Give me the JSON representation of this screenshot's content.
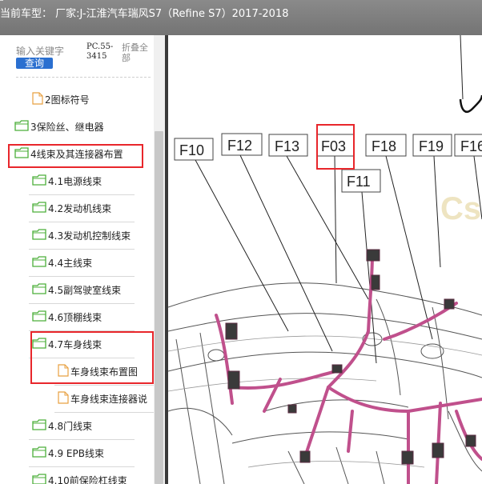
{
  "title_bar": {
    "text": "当前车型： 厂家:J-江淮汽车瑞风S7（Refine S7）2017-2018"
  },
  "search": {
    "placeholder": "输入关键字",
    "button_label": "查询",
    "code_text": "PC.55-\n3415",
    "collapse_label": "折叠全部"
  },
  "tree": {
    "items": [
      {
        "label": "2图标符号",
        "type": "file"
      },
      {
        "label": "3保险丝、继电器",
        "type": "folder"
      },
      {
        "label": "4线束及其连接器布置",
        "type": "folder"
      },
      {
        "label": "4.1电源线束",
        "type": "folder"
      },
      {
        "label": "4.2发动机线束",
        "type": "folder"
      },
      {
        "label": "4.3发动机控制线束",
        "type": "folder"
      },
      {
        "label": "4.4主线束",
        "type": "folder"
      },
      {
        "label": "4.5副驾驶室线束",
        "type": "folder"
      },
      {
        "label": "4.6顶棚线束",
        "type": "folder"
      },
      {
        "label": "4.7车身线束",
        "type": "folder"
      },
      {
        "label": "车身线束布置图",
        "type": "file"
      },
      {
        "label": "车身线束连接器说",
        "type": "file"
      },
      {
        "label": "4.8门线束",
        "type": "folder"
      },
      {
        "label": "4.9 EPB线束",
        "type": "folder"
      },
      {
        "label": "4.10前保险杠线束",
        "type": "folder"
      }
    ]
  },
  "diagram": {
    "labels": [
      "F10",
      "F12",
      "F13",
      "F03",
      "F18",
      "F19",
      "F16",
      "F11"
    ]
  },
  "colors": {
    "folder": "#4caf3a",
    "file": "#e8a040",
    "highlight": "#e8262b",
    "harness": "#c0508c",
    "button": "#2a6fd0"
  }
}
